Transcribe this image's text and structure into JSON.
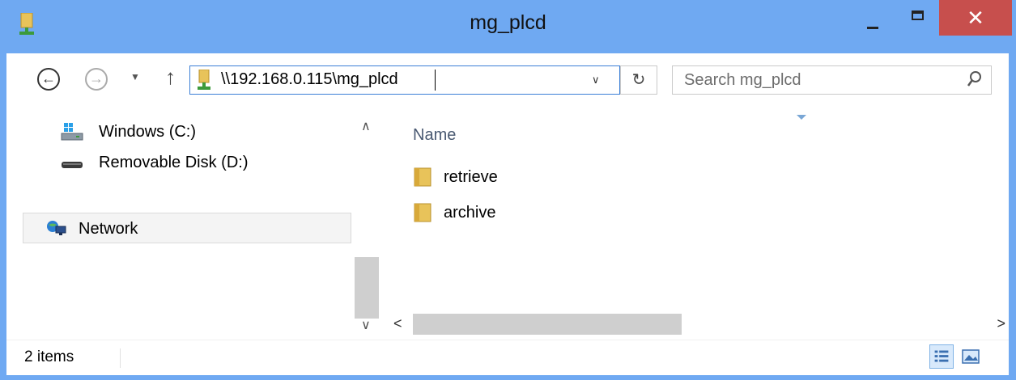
{
  "window": {
    "title": "mg_plcd",
    "close_glyph": "✕"
  },
  "toolbar": {
    "back_glyph": "←",
    "forward_glyph": "→",
    "recent_glyph": "▼",
    "up_glyph": "↑",
    "address": "\\\\192.168.0.115\\mg_plcd",
    "address_dropdown_glyph": "∨",
    "refresh_glyph": "↻",
    "search_placeholder": "Search mg_plcd"
  },
  "nav_pane": {
    "items": [
      {
        "label": "Windows (C:)",
        "icon": "drive-windows-icon"
      },
      {
        "label": "Removable Disk (D:)",
        "icon": "removable-disk-icon"
      }
    ],
    "network": {
      "label": "Network",
      "icon": "network-icon"
    },
    "scroll_up_glyph": "∧",
    "scroll_down_glyph": "∨"
  },
  "file_pane": {
    "column_header": "Name",
    "files": [
      {
        "name": "retrieve",
        "icon": "folder-icon"
      },
      {
        "name": "archive",
        "icon": "folder-icon"
      }
    ],
    "scroll_left_glyph": "<",
    "scroll_right_glyph": ">"
  },
  "status_bar": {
    "item_count": "2 items"
  },
  "colors": {
    "frame": "#6fa9f2",
    "close": "#c74f4d",
    "address_border": "#3c7fd6",
    "folder": "#e8c35a"
  }
}
